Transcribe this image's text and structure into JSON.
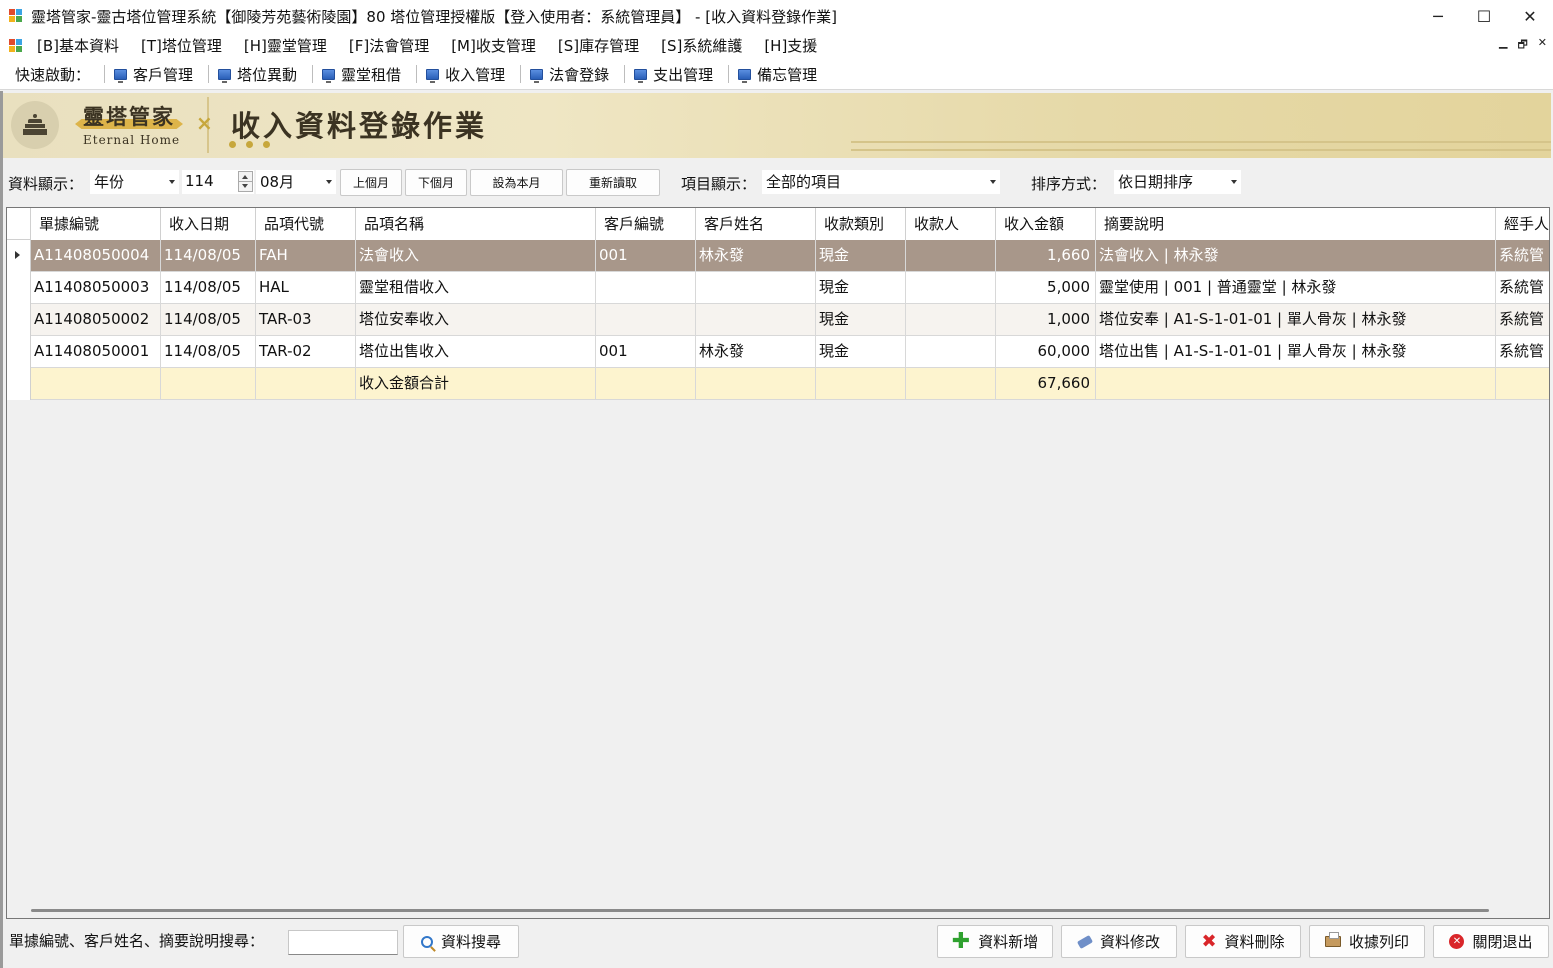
{
  "window": {
    "title": "靈塔管家-靈古塔位管理系統【御陵芳苑藝術陵園】80 塔位管理授權版【登入使用者：系統管理員】 - [收入資料登錄作業]",
    "minimize": "─",
    "maximize": "☐",
    "close": "✕"
  },
  "menu": {
    "items": [
      "[B]基本資料",
      "[T]塔位管理",
      "[H]靈堂管理",
      "[F]法會管理",
      "[M]收支管理",
      "[S]庫存管理",
      "[S]系統維護",
      "[H]支援"
    ],
    "mdi_min": "▁",
    "mdi_restore": "🗗",
    "mdi_close": "✕"
  },
  "quick_launch": {
    "label": "快速啟動：",
    "items": [
      "客戶管理",
      "塔位異動",
      "靈堂租借",
      "收入管理",
      "法會登錄",
      "支出管理",
      "備忘管理"
    ]
  },
  "banner": {
    "brand_cn": "靈塔管家",
    "brand_en": "Eternal Home",
    "page_title": "收入資料登錄作業"
  },
  "filters": {
    "display_label": "資料顯示：",
    "period_type": "年份",
    "year": "114",
    "month": "08月",
    "prev_month": "上個月",
    "next_month": "下個月",
    "set_current_month": "設為本月",
    "reload": "重新讀取",
    "item_label": "項目顯示：",
    "item_value": "全部的項目",
    "sort_label": "排序方式：",
    "sort_value": "依日期排序"
  },
  "grid": {
    "columns": [
      "單據編號",
      "收入日期",
      "品項代號",
      "品項名稱",
      "客戶編號",
      "客戶姓名",
      "收款類別",
      "收款人",
      "收入金額",
      "摘要說明",
      "經手人"
    ],
    "rows": [
      [
        "A11408050004",
        "114/08/05",
        "FAH",
        "法會收入",
        "001",
        "林永發",
        "現金",
        "",
        "1,660",
        "法會收入 | 林永發",
        "系統管"
      ],
      [
        "A11408050003",
        "114/08/05",
        "HAL",
        "靈堂租借收入",
        "",
        "",
        "現金",
        "",
        "5,000",
        "靈堂使用 | 001 | 普通靈堂 | 林永發",
        "系統管"
      ],
      [
        "A11408050002",
        "114/08/05",
        "TAR-03",
        "塔位安奉收入",
        "",
        "",
        "現金",
        "",
        "1,000",
        "塔位安奉 | A1-S-1-01-01 | 單人骨灰 | 林永發",
        "系統管"
      ],
      [
        "A11408050001",
        "114/08/05",
        "TAR-02",
        "塔位出售收入",
        "001",
        "林永發",
        "現金",
        "",
        "60,000",
        "塔位出售 | A1-S-1-01-01 | 單人骨灰 | 林永發",
        "系統管"
      ]
    ],
    "total": {
      "label": "收入金額合計",
      "amount": "67,660"
    }
  },
  "bottom": {
    "search_label": "單據編號、客戶姓名、摘要說明搜尋：",
    "search_value": "",
    "search_button": "資料搜尋",
    "add_button": "資料新增",
    "edit_button": "資料修改",
    "delete_button": "資料刪除",
    "print_button": "收據列印",
    "exit_button": "關閉退出"
  }
}
